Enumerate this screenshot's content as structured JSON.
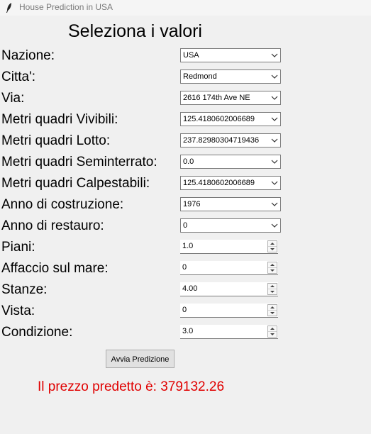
{
  "window": {
    "title": "House Prediction in USA",
    "icon": "feather-icon"
  },
  "heading": "Seleziona i valori",
  "fields": {
    "nazione": {
      "label": "Nazione:",
      "value": "USA"
    },
    "citta": {
      "label": "Citta':",
      "value": "Redmond"
    },
    "via": {
      "label": "Via:",
      "value": "2616 174th Ave NE"
    },
    "mq_vivibili": {
      "label": "Metri quadri Vivibili:",
      "value": "125.4180602006689"
    },
    "mq_lotto": {
      "label": "Metri quadri Lotto:",
      "value": "237.82980304719436"
    },
    "mq_seminterrato": {
      "label": "Metri quadri Seminterrato:",
      "value": "0.0"
    },
    "mq_calpestabili": {
      "label": "Metri quadri Calpestabili:",
      "value": "125.4180602006689"
    },
    "anno_costruzione": {
      "label": "Anno di costruzione:",
      "value": "1976"
    },
    "anno_restauro": {
      "label": "Anno di restauro:",
      "value": "0"
    },
    "piani": {
      "label": "Piani:",
      "value": "1.0"
    },
    "affaccio": {
      "label": "Affaccio sul mare:",
      "value": "0"
    },
    "stanze": {
      "label": "Stanze:",
      "value": "4.00"
    },
    "vista": {
      "label": "Vista:",
      "value": "0"
    },
    "condizione": {
      "label": "Condizione:",
      "value": "3.0"
    }
  },
  "predict_button": "Avvia Predizione",
  "result": "Il prezzo predetto è: 379132.26",
  "colors": {
    "result_text": "#e00000",
    "background": "#f0f0f0"
  }
}
